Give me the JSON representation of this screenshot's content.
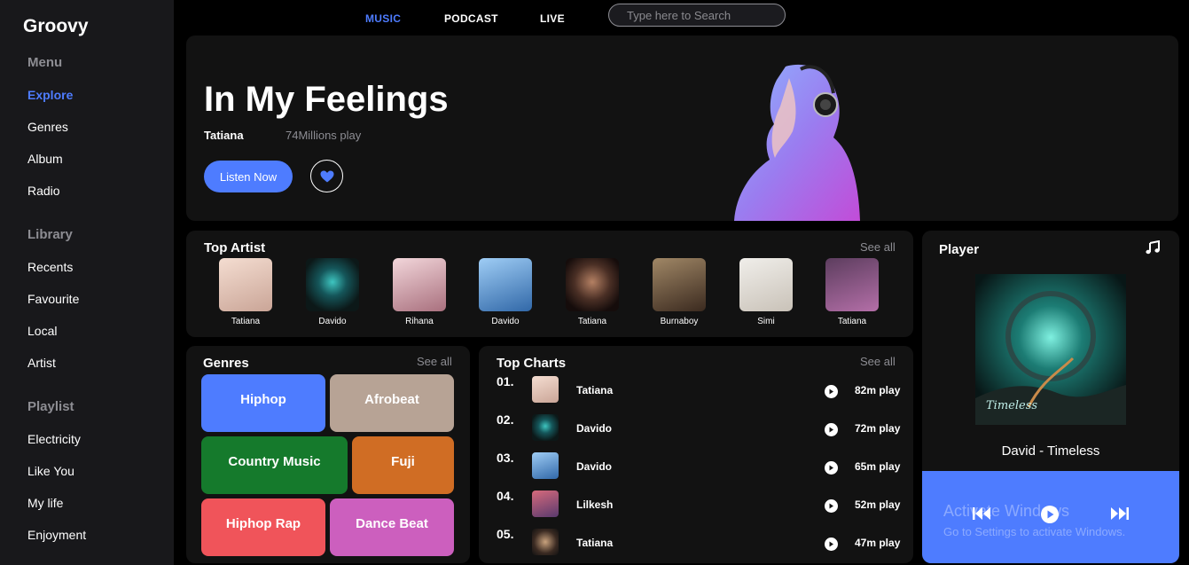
{
  "app": {
    "name": "Groovy"
  },
  "sidebar": {
    "menu_heading": "Menu",
    "menu": [
      "Explore",
      "Genres",
      "Album",
      "Radio"
    ],
    "library_heading": "Library",
    "library": [
      "Recents",
      "Favourite",
      "Local",
      "Artist"
    ],
    "playlist_heading": "Playlist",
    "playlist": [
      "Electricity",
      "Like You",
      "My life",
      "Enjoyment"
    ]
  },
  "topnav": {
    "tabs": [
      "MUSIC",
      "PODCAST",
      "LIVE"
    ],
    "active_tab": "MUSIC",
    "search_placeholder": "Type here to Search"
  },
  "hero": {
    "title": "In My Feelings",
    "artist": "Tatiana",
    "plays": "74Millions play",
    "listen_label": "Listen Now"
  },
  "top_artist": {
    "title": "Top Artist",
    "see_all": "See all",
    "artists": [
      "Tatiana",
      "Davido",
      "Rihana",
      "Davido",
      "Tatiana",
      "Burnaboy",
      "Simi",
      "Tatiana"
    ]
  },
  "genres": {
    "title": "Genres",
    "see_all": "See all",
    "items": [
      {
        "label": "Hiphop",
        "color": "#4e7cff"
      },
      {
        "label": "Afrobeat",
        "color": "#b7a395"
      },
      {
        "label": "Country Music",
        "color": "#157a2c"
      },
      {
        "label": "Fuji",
        "color": "#d06d24"
      },
      {
        "label": "Hiphop Rap",
        "color": "#f0545a"
      },
      {
        "label": "Dance Beat",
        "color": "#cc5fbe"
      }
    ]
  },
  "top_charts": {
    "title": "Top Charts",
    "see_all": "See all",
    "rows": [
      {
        "rank": "01.",
        "artist": "Tatiana",
        "plays": "82m play"
      },
      {
        "rank": "02.",
        "artist": "Davido",
        "plays": "72m play"
      },
      {
        "rank": "03.",
        "artist": "Davido",
        "plays": "65m play"
      },
      {
        "rank": "04.",
        "artist": "Lilkesh",
        "plays": "52m play"
      },
      {
        "rank": "05.",
        "artist": "Tatiana",
        "plays": "47m play"
      }
    ]
  },
  "player": {
    "title": "Player",
    "track": "David - Timeless",
    "album_text": "Timeless",
    "watermark_line1": "Activate Windows",
    "watermark_line2": "Go to Settings to activate Windows."
  },
  "colors": {
    "accent": "#4e7cff",
    "panel": "#121212",
    "sidebar": "#18181b"
  }
}
